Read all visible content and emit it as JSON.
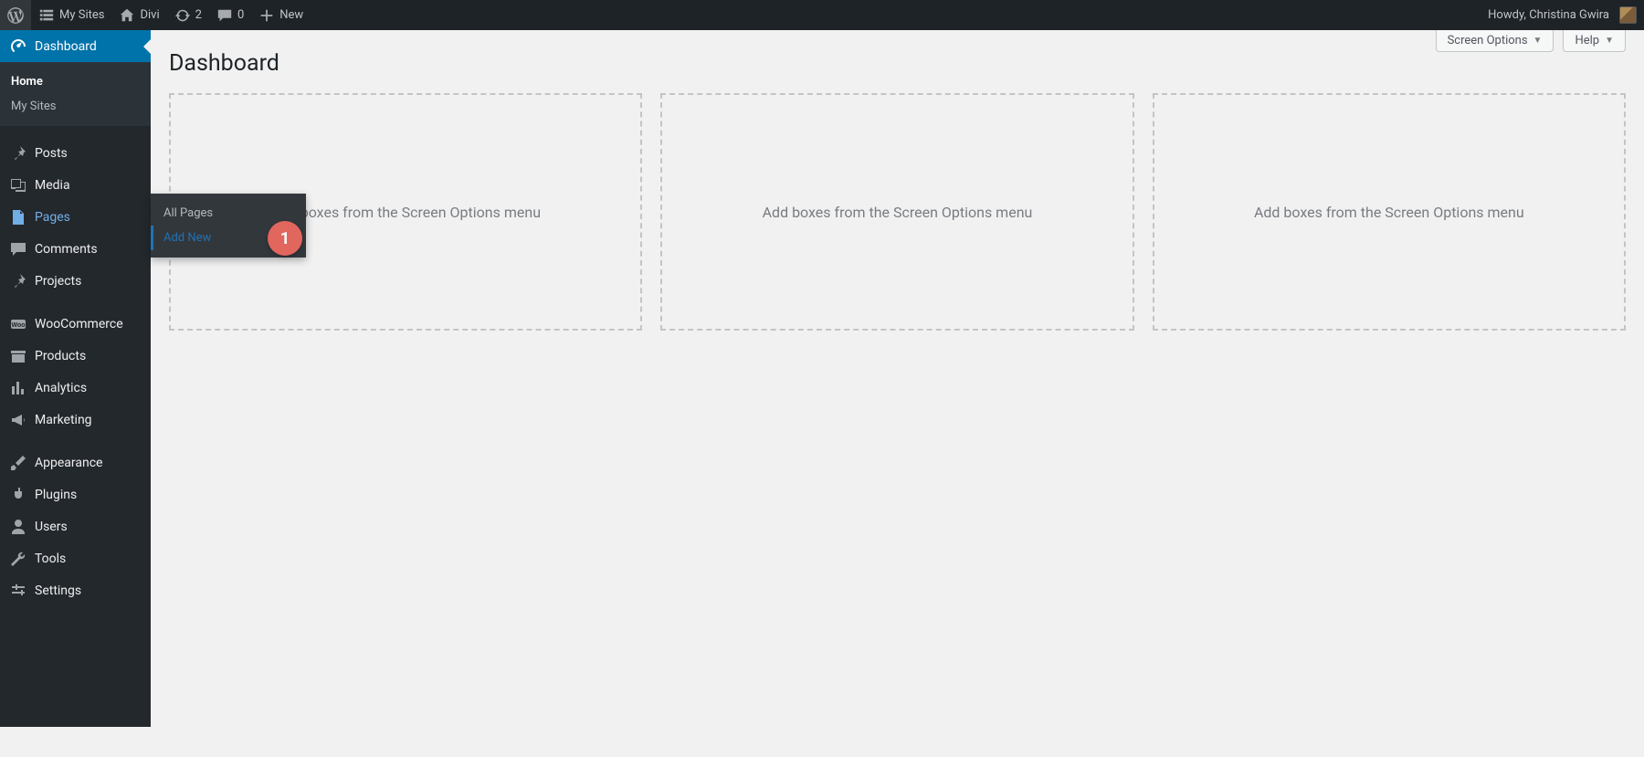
{
  "adminbar": {
    "left": [
      {
        "name": "wp-logo",
        "icon": "wordpress",
        "label": ""
      },
      {
        "name": "my-sites",
        "icon": "multisite",
        "label": "My Sites"
      },
      {
        "name": "site-name",
        "icon": "home",
        "label": "Divi"
      },
      {
        "name": "updates",
        "icon": "refresh",
        "label": "2"
      },
      {
        "name": "comments",
        "icon": "comment",
        "label": "0"
      },
      {
        "name": "new",
        "icon": "plus",
        "label": "New"
      }
    ],
    "right": {
      "greeting": "Howdy, Christina Gwira"
    }
  },
  "sidebar": {
    "groups": [
      [
        {
          "name": "dashboard",
          "icon": "gauge",
          "label": "Dashboard",
          "current": true,
          "sub": [
            {
              "name": "home",
              "label": "Home",
              "current": true
            },
            {
              "name": "my-sites",
              "label": "My Sites"
            }
          ]
        }
      ],
      [
        {
          "name": "posts",
          "icon": "pin",
          "label": "Posts"
        },
        {
          "name": "media",
          "icon": "media",
          "label": "Media"
        },
        {
          "name": "pages",
          "icon": "page",
          "label": "Pages",
          "highlight": true,
          "flyout": [
            {
              "name": "all-pages",
              "label": "All Pages"
            },
            {
              "name": "add-new",
              "label": "Add New",
              "active": true
            }
          ]
        },
        {
          "name": "comments",
          "icon": "comment",
          "label": "Comments"
        },
        {
          "name": "projects",
          "icon": "pin",
          "label": "Projects"
        }
      ],
      [
        {
          "name": "woocommerce",
          "icon": "woo",
          "label": "WooCommerce"
        },
        {
          "name": "products",
          "icon": "archive",
          "label": "Products"
        },
        {
          "name": "analytics",
          "icon": "chart",
          "label": "Analytics"
        },
        {
          "name": "marketing",
          "icon": "megaphone",
          "label": "Marketing"
        }
      ],
      [
        {
          "name": "appearance",
          "icon": "brush",
          "label": "Appearance"
        },
        {
          "name": "plugins",
          "icon": "plug",
          "label": "Plugins"
        },
        {
          "name": "users",
          "icon": "user",
          "label": "Users"
        },
        {
          "name": "tools",
          "icon": "wrench",
          "label": "Tools"
        },
        {
          "name": "settings",
          "icon": "sliders",
          "label": "Settings"
        }
      ]
    ]
  },
  "content": {
    "title": "Dashboard",
    "screen_options": "Screen Options",
    "help": "Help",
    "box_placeholder": "Add boxes from the Screen Options menu"
  },
  "annotation": {
    "marker1": "1"
  }
}
